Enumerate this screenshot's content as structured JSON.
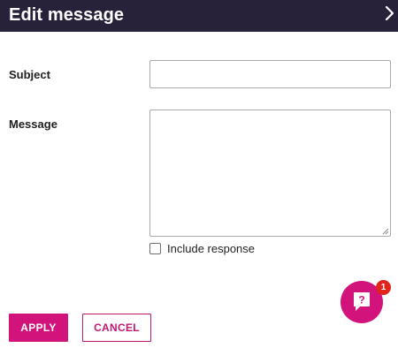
{
  "header": {
    "title": "Edit message",
    "collapse_icon": "chevron-right-icon"
  },
  "form": {
    "subject_label": "Subject",
    "subject_value": "",
    "message_label": "Message",
    "message_value": "",
    "include_response_label": "Include response",
    "include_response_checked": false
  },
  "actions": {
    "apply_label": "APPLY",
    "cancel_label": "CANCEL"
  },
  "help": {
    "icon": "help-chat-icon",
    "badge_count": "1"
  },
  "colors": {
    "header_bg": "#27213a",
    "accent": "#d3137c",
    "badge": "#e0241c"
  }
}
